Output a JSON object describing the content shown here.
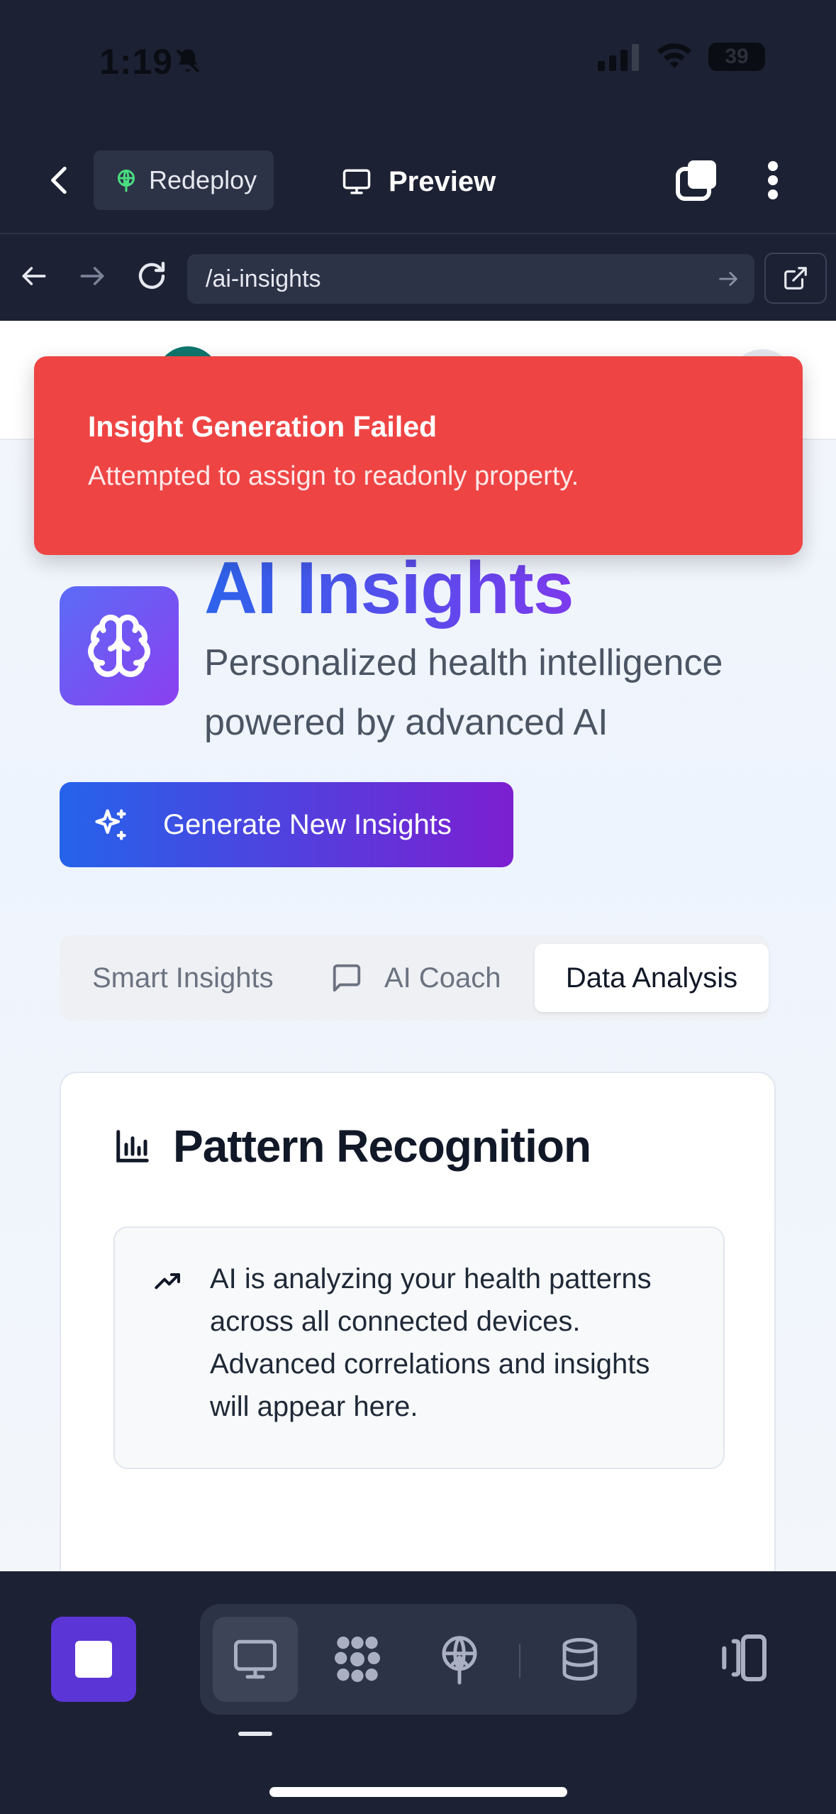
{
  "status_bar": {
    "time": "1:19",
    "battery": "39"
  },
  "header": {
    "redeploy_label": "Redeploy",
    "preview_label": "Preview"
  },
  "browser": {
    "url": "/ai-insights"
  },
  "toast": {
    "title": "Insight Generation Failed",
    "message": "Attempted to assign to readonly property."
  },
  "hero": {
    "title": "AI Insights",
    "subtitle": "Personalized health intelligence powered by advanced AI",
    "generate_label": "Generate New Insights"
  },
  "tabs": [
    {
      "label": "Smart Insights",
      "active": false
    },
    {
      "label": "AI Coach",
      "active": false
    },
    {
      "label": "Data Analysis",
      "active": true
    }
  ],
  "card": {
    "title": "Pattern Recognition",
    "info": "AI is analyzing your health patterns across all connected devices. Advanced correlations and insights will appear here."
  },
  "colors": {
    "toast_bg": "#ef4444",
    "accent_blue": "#2563eb",
    "accent_purple": "#7c3aed",
    "app_chrome": "#1c2133",
    "stop_button": "#5b35d5"
  },
  "icons": {
    "back": "chevron-left-icon",
    "redeploy": "globe-upload-icon",
    "preview": "monitor-icon",
    "tabs": "tabs-icon",
    "menu": "kebab-icon",
    "hero": "brain-icon",
    "generate": "sparkles-icon",
    "coach": "message-square-icon",
    "pattern": "bar-chart-icon",
    "trend": "trending-up-icon"
  }
}
